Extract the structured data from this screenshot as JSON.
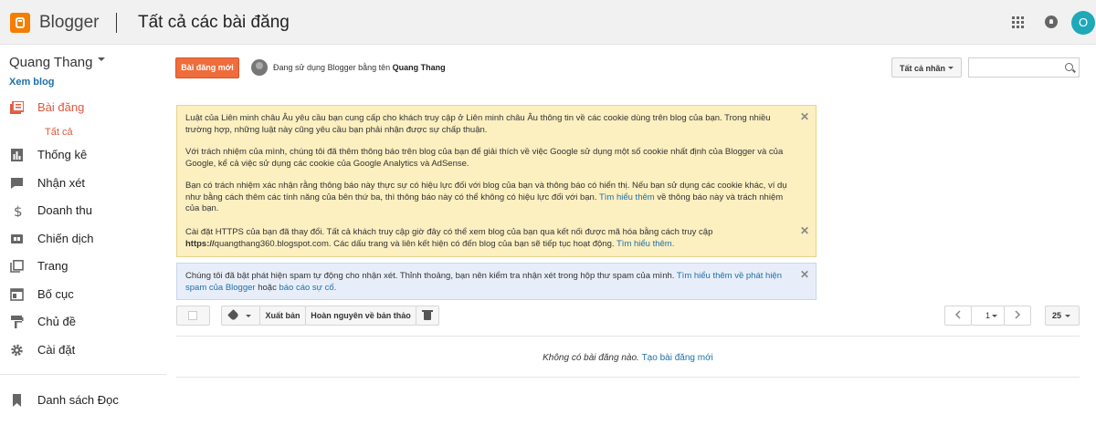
{
  "header": {
    "brand": "Blogger",
    "title": "Tất cả các bài đăng",
    "avatar_letter": "O",
    "avatar_color": "#1fa9b8"
  },
  "sidebar": {
    "blog_name": "Quang Thang",
    "view_blog": "Xem blog",
    "items": [
      {
        "label": "Bài đăng",
        "icon": "posts-icon",
        "active": true
      },
      {
        "label": "Thống kê",
        "icon": "stats-icon"
      },
      {
        "label": "Nhận xét",
        "icon": "comments-icon"
      },
      {
        "label": "Doanh thu",
        "icon": "dollar-icon"
      },
      {
        "label": "Chiến dịch",
        "icon": "ad-icon"
      },
      {
        "label": "Trang",
        "icon": "pages-icon"
      },
      {
        "label": "Bố cục",
        "icon": "layout-icon"
      },
      {
        "label": "Chủ đề",
        "icon": "theme-icon"
      },
      {
        "label": "Cài đặt",
        "icon": "gear-icon"
      },
      {
        "label": "Danh sách Đọc",
        "icon": "bookmark-icon"
      }
    ],
    "sub_all": "Tất cả"
  },
  "toolbar": {
    "new_post": "Bài đăng mới",
    "using_prefix": "Đang sử dụng Blogger bằng tên",
    "using_name": "Quang Thang",
    "labels_dropdown": "Tất cả nhãn",
    "search_placeholder": ""
  },
  "notices": {
    "cookie_p1": "Luật của Liên minh châu Âu yêu cầu bạn cung cấp cho khách truy cập ở Liên minh châu Âu thông tin về các cookie dùng trên blog của bạn. Trong nhiều trường hợp, những luật này cũng yêu cầu bạn phải nhận được sự chấp thuận.",
    "cookie_p2": "Với trách nhiệm của mình, chúng tôi đã thêm thông báo trên blog của bạn để giải thích về việc Google sử dụng một số cookie nhất định của Blogger và của Google, kể cả việc sử dụng các cookie của Google Analytics và AdSense.",
    "cookie_p3": "Bạn có trách nhiệm xác nhận rằng thông báo này thực sự có hiệu lực đối với blog của bạn và thông báo có hiển thị. Nếu bạn sử dụng các cookie khác, ví dụ như bằng cách thêm các tính năng của bên thứ ba, thì thông báo này có thể không có hiệu lực đối với bạn.",
    "cookie_link": "Tìm hiểu thêm",
    "cookie_p3_end": "về thông báo này và trách nhiệm của bạn.",
    "https_text": "Cài đặt HTTPS của bạn đã thay đổi. Tất cả khách truy cập giờ đây có thể xem blog của bạn qua kết nối được mã hóa bằng cách truy cập",
    "https_url": "https://",
    "https_url_rest": "quangthang360.blogspot.com. Các dấu trang và liên kết hiện có đến blog của bạn sẽ tiếp tục hoạt động.",
    "https_link": "Tìm hiểu thêm.",
    "spam_text": "Chúng tôi đã bật phát hiện spam tự động cho nhận xét. Thỉnh thoảng, bạn nên kiểm tra nhận xét trong hộp thư spam của mình.",
    "spam_link": "Tìm hiểu thêm về phát hiện spam của Blogger",
    "spam_or": "hoặc",
    "spam_link2": "báo cáo sự cố."
  },
  "actions": {
    "publish": "Xuất bản",
    "revert": "Hoàn nguyên về bản thảo",
    "page": "1",
    "page_size": "25"
  },
  "empty": {
    "text": "Không có bài đăng nào.",
    "link": "Tạo bài đăng mới"
  }
}
